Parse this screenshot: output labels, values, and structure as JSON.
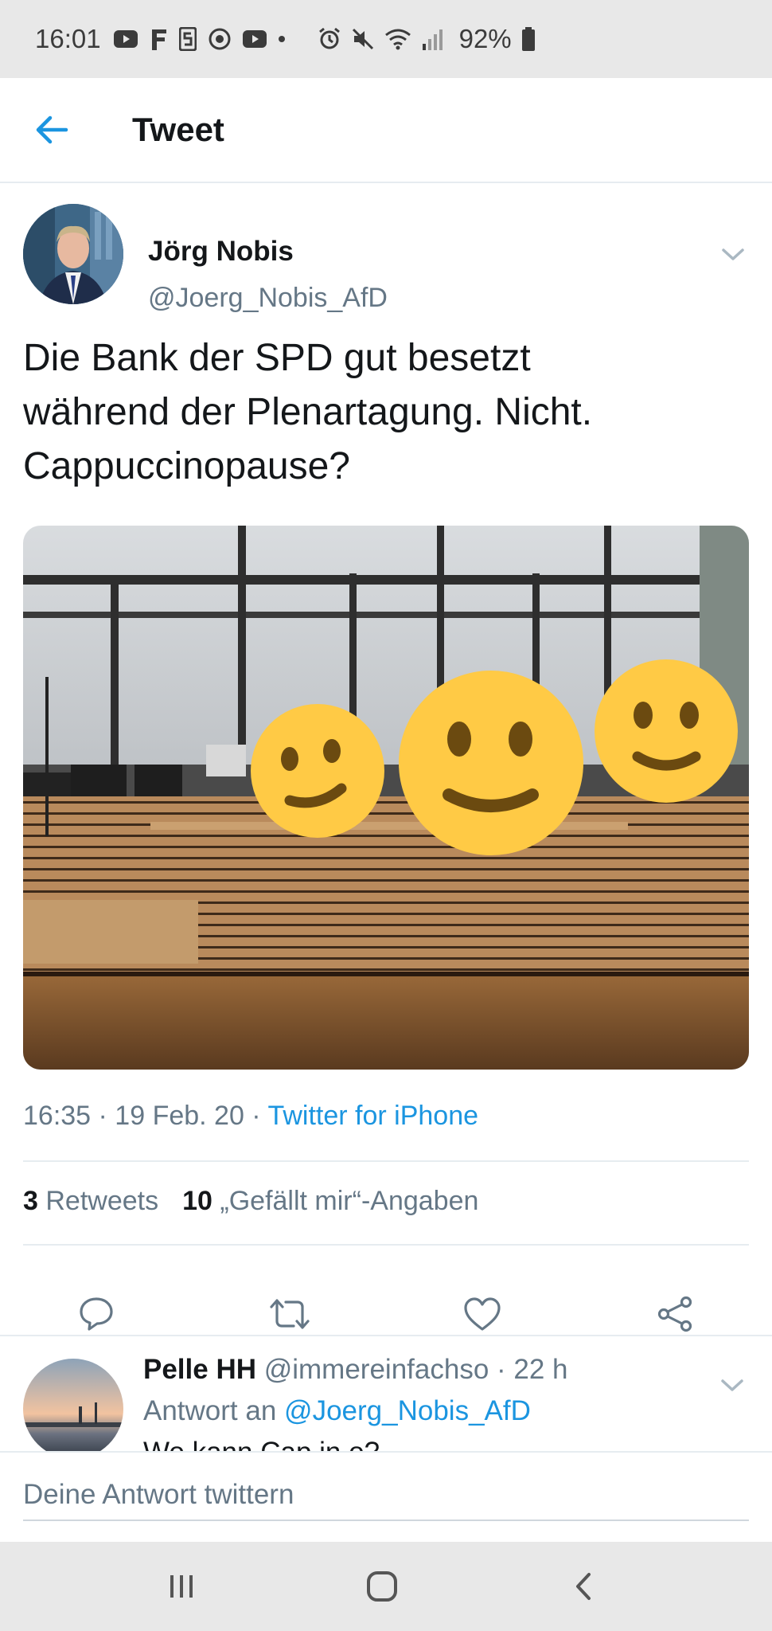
{
  "status_bar": {
    "time": "16:01",
    "battery": "92%",
    "left_icons": [
      "youtube-icon",
      "f-icon",
      "s-icon",
      "app-icon",
      "youtube-icon",
      "dot-icon"
    ],
    "right_icons": [
      "alarm-icon",
      "mute-icon",
      "wifi-icon",
      "signal-icon",
      "battery-icon"
    ]
  },
  "header": {
    "title": "Tweet",
    "back_icon": "arrow-left-icon"
  },
  "tweet": {
    "author_name": "Jörg Nobis",
    "author_handle": "@Joerg_Nobis_AfD",
    "text_lines": [
      "Die Bank der SPD gut besetzt",
      "während der Plenartagung. Nicht.",
      "Cappuccinopause?"
    ],
    "timestamp": "16:35 · 19 Feb. 20 · ",
    "source": "Twitter for iPhone",
    "retweets_count": "3",
    "retweets_label": "Retweets",
    "likes_count": "10",
    "likes_label": "„Gefällt mir“-Angaben"
  },
  "actions": [
    "reply-icon",
    "retweet-icon",
    "like-icon",
    "share-icon"
  ],
  "reply": {
    "name": "Pelle HH",
    "handle_time": " @immereinfachso · 22 h",
    "reply_prefix": "Antwort an ",
    "reply_mention": "@Joerg_Nobis_AfD",
    "partial_text": "Wo kann Cap in o?"
  },
  "compose": {
    "placeholder": "Deine Antwort twittern"
  },
  "colors": {
    "accent": "#1b95e0",
    "secondary_text": "#657786",
    "divider": "#e6ecf0",
    "system_bar": "#e8e8e8"
  }
}
